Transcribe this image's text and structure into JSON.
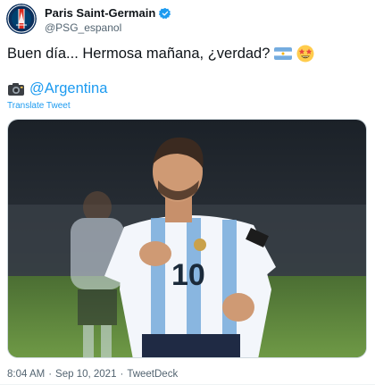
{
  "author": {
    "display_name": "Paris Saint-Germain",
    "handle": "@PSG_espanol",
    "verified": true,
    "avatar_icon": "psg-crest-icon"
  },
  "tweet": {
    "text": "Buen día... Hermosa mañana, ¿verdad?",
    "text_emojis": [
      "argentina-flag",
      "star-struck-face"
    ],
    "mention_icon": "camera-flash-icon",
    "mention": "@Argentina",
    "translate_label": "Translate Tweet"
  },
  "media": {
    "type": "photo",
    "jersey_number": "10"
  },
  "meta": {
    "time": "8:04 AM",
    "separator": "·",
    "date": "Sep 10, 2021",
    "source": "TweetDeck"
  },
  "colors": {
    "link": "#1d9bf0",
    "text": "#0f1419",
    "secondary": "#536471",
    "psg_navy": "#004170",
    "psg_red": "#da291c"
  }
}
